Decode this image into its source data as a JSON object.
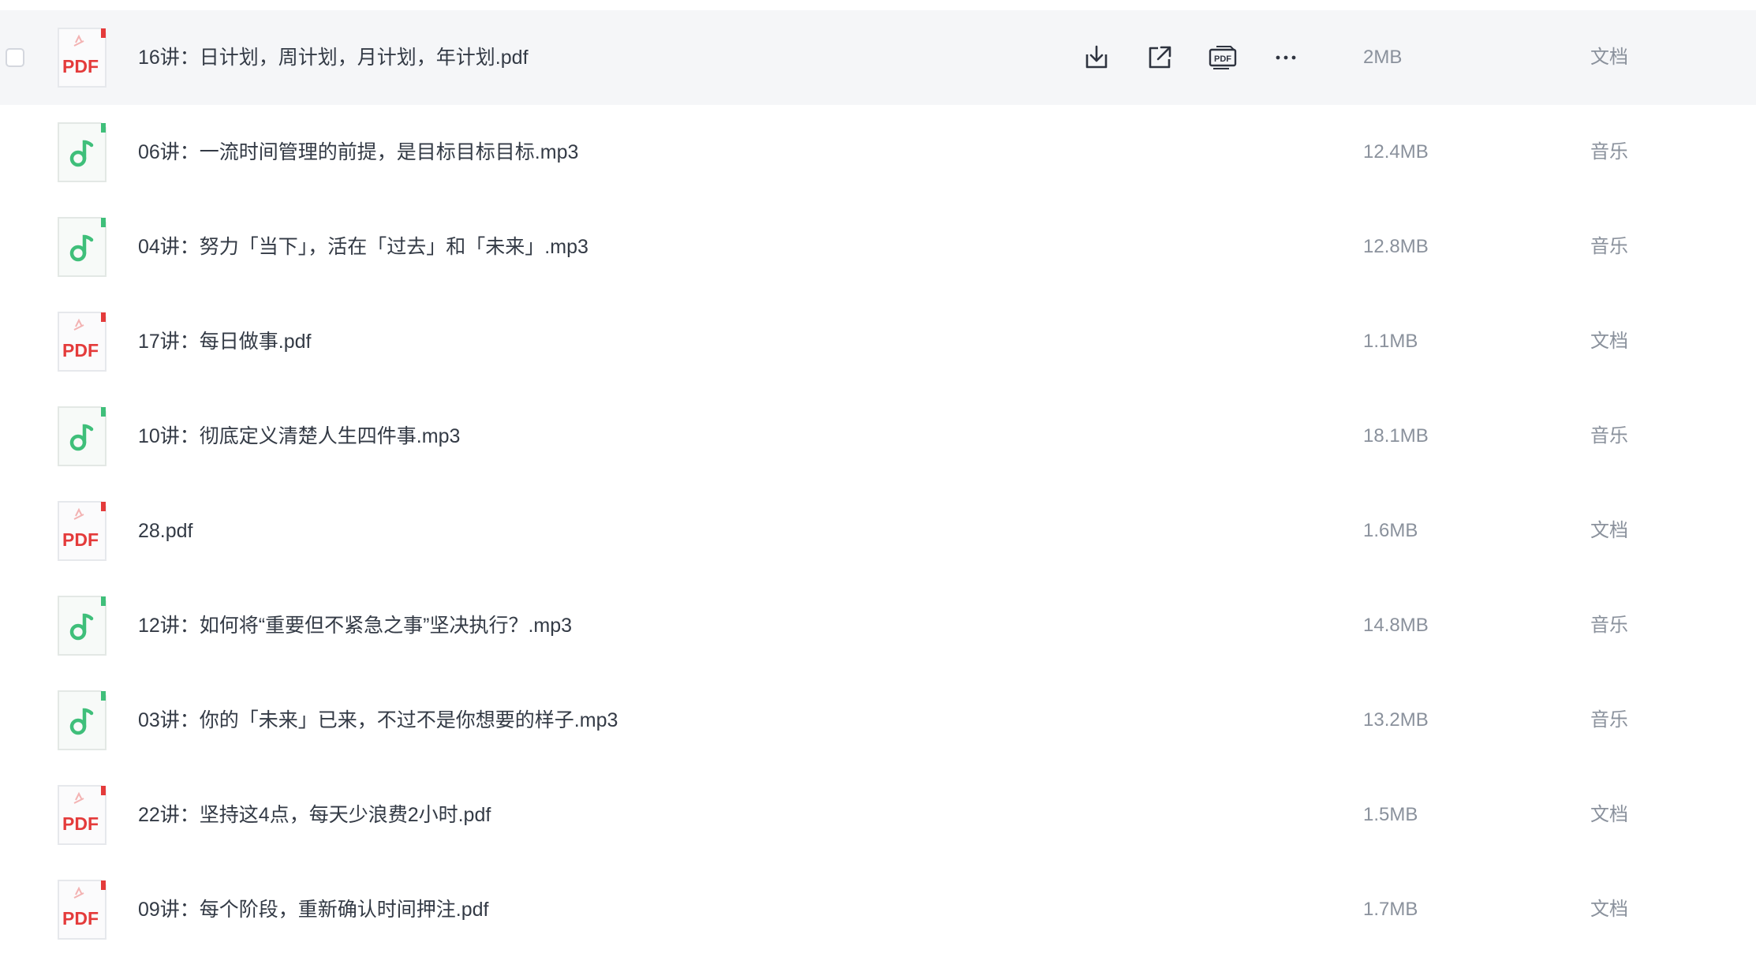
{
  "colors": {
    "selected_row_bg": "#f5f6f8",
    "pdf_icon_red": "#e43b3b",
    "audio_icon_green": "#3fbf7a",
    "text_primary": "#333a45",
    "text_secondary": "#8a919c"
  },
  "row_actions": {
    "download_icon": "download-icon",
    "share_icon": "share-icon",
    "pdf_convert_icon": "pdf-icon",
    "more_icon": "more-icon",
    "pdf_convert_label": "PDF",
    "more_label": "···"
  },
  "file_icons": {
    "pdf_label": "PDF",
    "pdf_icon": "pdf-file-icon",
    "audio_icon": "music-note-icon"
  },
  "files": [
    {
      "name": "16讲：日计划，周计划，月计划，年计划.pdf",
      "size": "2MB",
      "category": "文档",
      "kind": "pdf",
      "selected": true
    },
    {
      "name": "06讲：一流时间管理的前提，是目标目标目标.mp3",
      "size": "12.4MB",
      "category": "音乐",
      "kind": "audio",
      "selected": false
    },
    {
      "name": "04讲：努力「当下」，活在「过去」和「未来」.mp3",
      "size": "12.8MB",
      "category": "音乐",
      "kind": "audio",
      "selected": false
    },
    {
      "name": "17讲：每日做事.pdf",
      "size": "1.1MB",
      "category": "文档",
      "kind": "pdf",
      "selected": false
    },
    {
      "name": "10讲：彻底定义清楚人生四件事.mp3",
      "size": "18.1MB",
      "category": "音乐",
      "kind": "audio",
      "selected": false
    },
    {
      "name": "28.pdf",
      "size": "1.6MB",
      "category": "文档",
      "kind": "pdf",
      "selected": false
    },
    {
      "name": "12讲：如何将“重要但不紧急之事”坚决执行？.mp3",
      "size": "14.8MB",
      "category": "音乐",
      "kind": "audio",
      "selected": false
    },
    {
      "name": "03讲：你的「未来」已来，不过不是你想要的样子.mp3",
      "size": "13.2MB",
      "category": "音乐",
      "kind": "audio",
      "selected": false
    },
    {
      "name": "22讲：坚持这4点，每天少浪费2小时.pdf",
      "size": "1.5MB",
      "category": "文档",
      "kind": "pdf",
      "selected": false
    },
    {
      "name": "09讲：每个阶段，重新确认时间押注.pdf",
      "size": "1.7MB",
      "category": "文档",
      "kind": "pdf",
      "selected": false
    }
  ]
}
